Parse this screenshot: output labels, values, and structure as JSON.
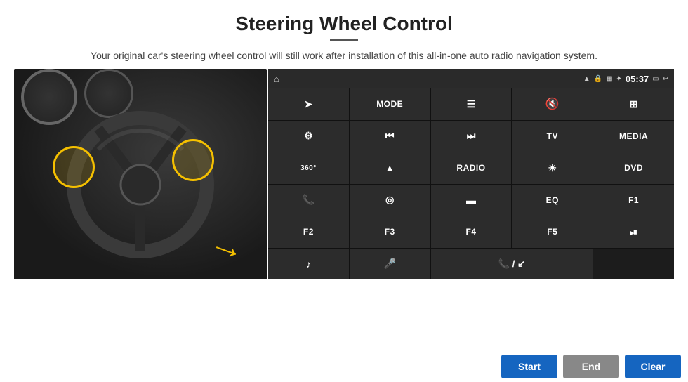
{
  "header": {
    "title": "Steering Wheel Control",
    "subtitle": "Your original car's steering wheel control will still work after installation of this all-in-one auto radio navigation system.",
    "divider": true
  },
  "status_bar": {
    "time": "05:37",
    "wifi_icon": "wifi",
    "lock_icon": "lock",
    "sim_icon": "sim",
    "bluetooth_icon": "bluetooth",
    "home_icon": "⌂",
    "back_icon": "↩"
  },
  "control_buttons": [
    {
      "id": "row1col1",
      "type": "icon",
      "icon": "➤",
      "label": "send"
    },
    {
      "id": "row1col2",
      "type": "text",
      "label": "MODE"
    },
    {
      "id": "row1col3",
      "type": "icon",
      "icon": "☰",
      "label": "menu"
    },
    {
      "id": "row1col4",
      "type": "icon",
      "icon": "🔇",
      "label": "mute"
    },
    {
      "id": "row1col5",
      "type": "icon",
      "icon": "⊞",
      "label": "grid"
    },
    {
      "id": "row2col1",
      "type": "icon",
      "icon": "⚙",
      "label": "settings"
    },
    {
      "id": "row2col2",
      "type": "icon",
      "icon": "⏮",
      "label": "prev"
    },
    {
      "id": "row2col3",
      "type": "icon",
      "icon": "⏭",
      "label": "next"
    },
    {
      "id": "row2col4",
      "type": "text",
      "label": "TV"
    },
    {
      "id": "row2col5",
      "type": "text",
      "label": "MEDIA"
    },
    {
      "id": "row3col1",
      "type": "icon",
      "icon": "360",
      "label": "360cam"
    },
    {
      "id": "row3col2",
      "type": "icon",
      "icon": "▲",
      "label": "eject"
    },
    {
      "id": "row3col3",
      "type": "text",
      "label": "RADIO"
    },
    {
      "id": "row3col4",
      "type": "icon",
      "icon": "☀",
      "label": "brightness"
    },
    {
      "id": "row3col5",
      "type": "text",
      "label": "DVD"
    },
    {
      "id": "row4col1",
      "type": "icon",
      "icon": "📞",
      "label": "phone"
    },
    {
      "id": "row4col2",
      "type": "icon",
      "icon": "◎",
      "label": "nav"
    },
    {
      "id": "row4col3",
      "type": "icon",
      "icon": "▬",
      "label": "screen"
    },
    {
      "id": "row4col4",
      "type": "text",
      "label": "EQ"
    },
    {
      "id": "row4col5",
      "type": "text",
      "label": "F1"
    },
    {
      "id": "row5col1",
      "type": "text",
      "label": "F2"
    },
    {
      "id": "row5col2",
      "type": "text",
      "label": "F3"
    },
    {
      "id": "row5col3",
      "type": "text",
      "label": "F4"
    },
    {
      "id": "row5col4",
      "type": "text",
      "label": "F5"
    },
    {
      "id": "row5col5",
      "type": "icon",
      "icon": "⏯",
      "label": "playpause"
    },
    {
      "id": "row6col1",
      "type": "icon",
      "icon": "♪",
      "label": "music"
    },
    {
      "id": "row6col2",
      "type": "icon",
      "icon": "🎤",
      "label": "mic"
    },
    {
      "id": "row6col3",
      "type": "icon",
      "icon": "📞↙",
      "label": "call-end"
    },
    {
      "id": "row6col4",
      "type": "empty",
      "label": ""
    },
    {
      "id": "row6col5",
      "type": "empty",
      "label": ""
    }
  ],
  "bottom_bar": {
    "start_label": "Start",
    "end_label": "End",
    "clear_label": "Clear"
  }
}
